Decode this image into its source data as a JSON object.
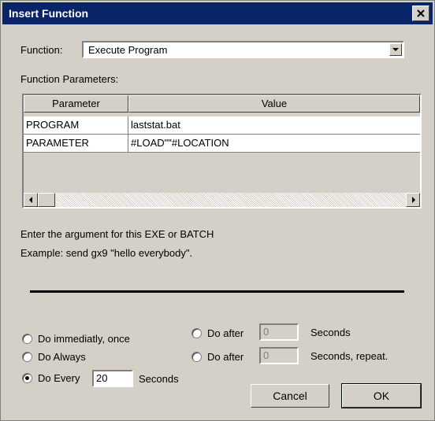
{
  "window": {
    "title": "Insert Function"
  },
  "function_label": "Function:",
  "function_value": "Execute Program",
  "params_label": "Function Parameters:",
  "grid": {
    "headers": [
      "Parameter",
      "Value"
    ],
    "rows": [
      [
        "PROGRAM",
        "laststat.bat"
      ],
      [
        "PARAMETER",
        "#LOAD\"\"#LOCATION"
      ]
    ]
  },
  "help": {
    "line1": "Enter the argument for this EXE or BATCH",
    "line2": "Example: send gx9 \"hello everybody\"."
  },
  "options": {
    "do_immediately": "Do immediatly, once",
    "do_always": "Do Always",
    "do_every": "Do Every",
    "do_every_value": "20",
    "do_every_unit": "Seconds",
    "do_after_1": "Do after",
    "do_after_1_value": "0",
    "do_after_1_unit": "Seconds",
    "do_after_2": "Do after",
    "do_after_2_value": "0",
    "do_after_2_unit": "Seconds, repeat.",
    "selected": "do_every"
  },
  "buttons": {
    "cancel": "Cancel",
    "ok": "OK"
  }
}
